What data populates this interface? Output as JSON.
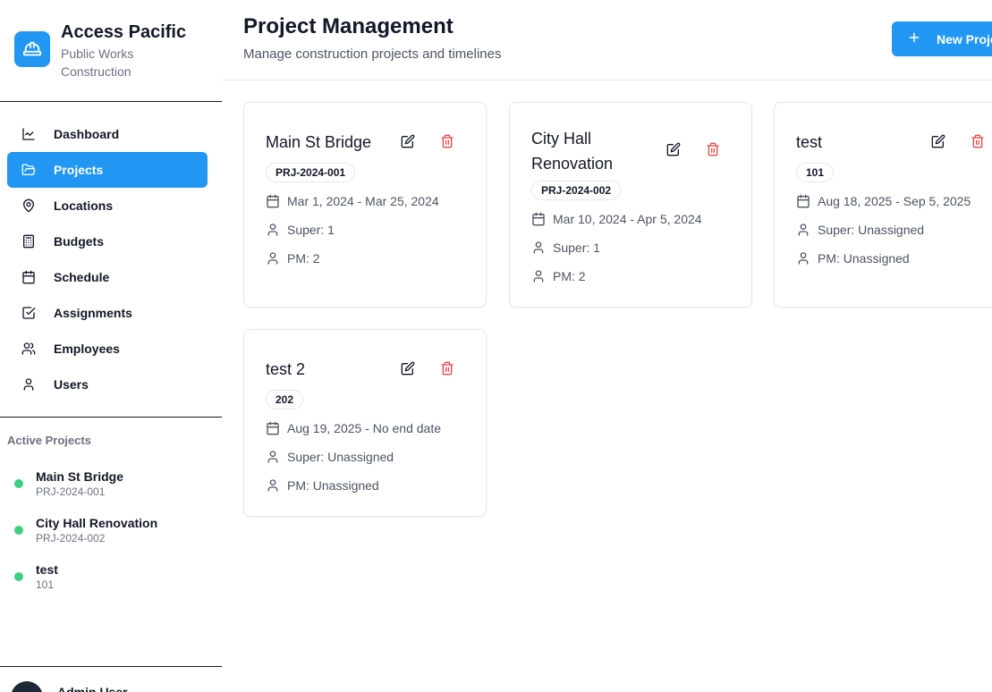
{
  "brand": {
    "name": "Access Pacific",
    "subtitle": "Public Works Construction",
    "logo_icon": "hard-hat-icon"
  },
  "nav": [
    {
      "label": "Dashboard",
      "icon": "chart-line-icon",
      "active": false
    },
    {
      "label": "Projects",
      "icon": "folder-open-icon",
      "active": true
    },
    {
      "label": "Locations",
      "icon": "map-pin-icon",
      "active": false
    },
    {
      "label": "Budgets",
      "icon": "calculator-icon",
      "active": false
    },
    {
      "label": "Schedule",
      "icon": "calendar-icon",
      "active": false
    },
    {
      "label": "Assignments",
      "icon": "check-square-icon",
      "active": false
    },
    {
      "label": "Employees",
      "icon": "users-icon",
      "active": false
    },
    {
      "label": "Users",
      "icon": "user-icon",
      "active": false
    }
  ],
  "active_projects": {
    "title": "Active Projects",
    "items": [
      {
        "name": "Main St Bridge",
        "code": "PRJ-2024-001"
      },
      {
        "name": "City Hall Renovation",
        "code": "PRJ-2024-002"
      },
      {
        "name": "test",
        "code": "101"
      }
    ]
  },
  "user": {
    "name": "Admin User"
  },
  "header": {
    "title": "Project Management",
    "subtitle": "Manage construction projects and timelines",
    "new_button": "New Project"
  },
  "projects": [
    {
      "title": "Main St Bridge",
      "code": "PRJ-2024-001",
      "dates": "Mar 1, 2024 - Mar 25, 2024",
      "super": "Super: 1",
      "pm": "PM: 2"
    },
    {
      "title": "City Hall Renovation",
      "code": "PRJ-2024-002",
      "dates": "Mar 10, 2024 - Apr 5, 2024",
      "super": "Super: 1",
      "pm": "PM: 2"
    },
    {
      "title": "test",
      "code": "101",
      "dates": "Aug 18, 2025 - Sep 5, 2025",
      "super": "Super: Unassigned",
      "pm": "PM: Unassigned"
    },
    {
      "title": "test 2",
      "code": "202",
      "dates": "Aug 19, 2025 - No end date",
      "super": "Super: Unassigned",
      "pm": "PM: Unassigned"
    }
  ],
  "colors": {
    "accent": "#2196f3",
    "danger": "#ef4444",
    "status_dot": "#3ecf7f"
  }
}
